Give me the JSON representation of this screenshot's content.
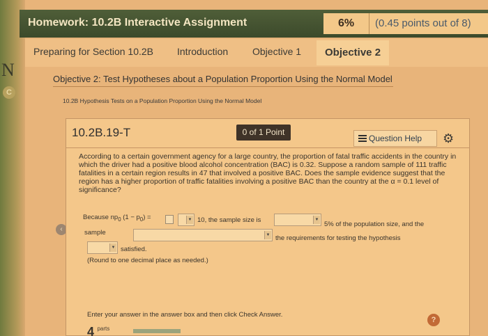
{
  "left": {
    "letter": "N",
    "circle": "C"
  },
  "homework": {
    "title": "Homework: 10.2B Interactive Assignment",
    "percent": "6%",
    "points": "(0.45 points out of 8)"
  },
  "tabs": [
    "Preparing for Section 10.2B",
    "Introduction",
    "Objective 1",
    "Objective 2"
  ],
  "objective_heading": "Objective 2: Test Hypotheses about a Population Proportion Using the Normal Model",
  "section_subheading": "10.2B Hypothesis Tests on a Population Proportion Using the Normal Model",
  "question": {
    "id": "10.2B.19-T",
    "points": "0 of 1 Point",
    "help_label": "Question Help",
    "problem": "According to a certain government agency for a large country, the proportion of fatal traffic accidents in the country in which the driver had a positive blood alcohol concentration (BAC) is 0.32. Suppose a random sample of 111 traffic fatalities in a certain region results in 47 that involved a positive BAC. Does the sample evidence suggest that the region has a higher proportion of traffic fatalities involving a positive BAC than the country at the α = 0.1 level of significance?",
    "because": "Because np",
    "formula": "(1 − p",
    "formula_close": ") =",
    "sub0": "0",
    "after_dd1": "10, the sample size is",
    "after_dd2": "5% of the population size, and the",
    "sample_label": "sample",
    "after_dd3": "the requirements for testing the hypothesis",
    "satisfied": "satisfied.",
    "round_note": "(Round to one decimal place as needed.)",
    "instruction": "Enter your answer in the answer box and then click Check Answer.",
    "parts_num": "4",
    "parts_label": "parts"
  },
  "icons": {
    "list": "list-icon",
    "gear": "gear-icon",
    "help": "?",
    "nav": "‹"
  }
}
